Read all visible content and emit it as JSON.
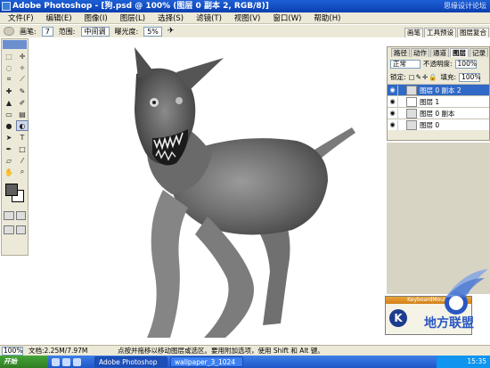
{
  "window": {
    "title": "Adobe Photoshop - [狗.psd @ 100% (图层 0 副本 2, RGB/8)]",
    "watermark": "思缘设计论坛"
  },
  "menu": [
    "文件(F)",
    "编辑(E)",
    "图像(I)",
    "图层(L)",
    "选择(S)",
    "滤镜(T)",
    "视图(V)",
    "窗口(W)",
    "帮助(H)"
  ],
  "options": {
    "brush_label": "画笔:",
    "brush_size": "7",
    "range_label": "范围:",
    "range_value": "中间调",
    "exposure_label": "曝光度:",
    "exposure_value": "5%"
  },
  "palette_well": [
    "画笔",
    "工具预设",
    "图层复合"
  ],
  "layers_panel": {
    "tabs": [
      "路径",
      "动作",
      "通道",
      "图层",
      "记录"
    ],
    "blend_mode": "正常",
    "opacity_label": "不透明度:",
    "opacity": "100%",
    "lock_label": "锁定:",
    "fill_label": "填充:",
    "fill": "100%",
    "layers": [
      {
        "name": "图层 0 副本 2",
        "selected": true
      },
      {
        "name": "图层 1",
        "selected": false
      },
      {
        "name": "图层 0 副本",
        "selected": false
      },
      {
        "name": "图层 0",
        "selected": false
      }
    ]
  },
  "popup": {
    "title": "KeyboardMouse",
    "letter": "K"
  },
  "status": {
    "zoom": "100%",
    "doc_size": "文档:2.25M/7.97M",
    "hint": "点按并拖移以移动图层或选区。要用附加选项，使用 Shift 和 Alt 键。"
  },
  "taskbar": {
    "start": "开始",
    "tasks": [
      "Adobe Photoshop",
      "wallpaper_3_1024"
    ],
    "time": "15:35"
  },
  "site_mark": "地方联盟"
}
